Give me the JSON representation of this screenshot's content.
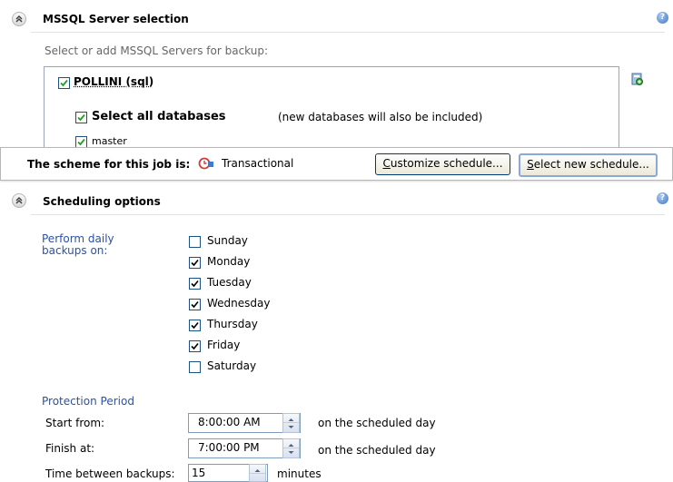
{
  "mssql_section": {
    "title": "MSSQL Server selection",
    "subtitle": "Select or add MSSQL Servers for backup:",
    "server": {
      "label": "POLLINI (sql)",
      "checked": true
    },
    "select_all": {
      "label": "Select all databases",
      "note": "(new databases will also be included)",
      "checked": true
    },
    "databases": [
      {
        "label": "master",
        "checked": true
      }
    ]
  },
  "scheme_bar": {
    "label": "The scheme for this job is:",
    "scheme_name": "Transactional",
    "customize_button": {
      "accel": "C",
      "rest": "ustomize schedule..."
    },
    "select_new_button": {
      "accel": "S",
      "rest": "elect new schedule..."
    }
  },
  "scheduling_section": {
    "title": "Scheduling options",
    "daily_label": "Perform daily backups on:",
    "days": [
      {
        "label": "Sunday",
        "checked": false
      },
      {
        "label": "Monday",
        "checked": true
      },
      {
        "label": "Tuesday",
        "checked": true
      },
      {
        "label": "Wednesday",
        "checked": true
      },
      {
        "label": "Thursday",
        "checked": true
      },
      {
        "label": "Friday",
        "checked": true
      },
      {
        "label": "Saturday",
        "checked": false
      }
    ],
    "protection_period": {
      "title": "Protection Period",
      "start_label": "Start from:",
      "start_value": "8:00:00 AM",
      "start_suffix": "on the scheduled day",
      "finish_label": "Finish at:",
      "finish_value": "7:00:00 PM",
      "finish_suffix": "on the scheduled day",
      "interval_label": "Time between backups:",
      "interval_value": "15",
      "interval_unit": "minutes"
    }
  },
  "colors": {
    "accent": "#2e51a1",
    "panel_border": "#9aa6b6"
  },
  "icons": [
    "collapse-chevron-up-icon",
    "help-icon",
    "add-server-icon",
    "scheme-icon"
  ]
}
